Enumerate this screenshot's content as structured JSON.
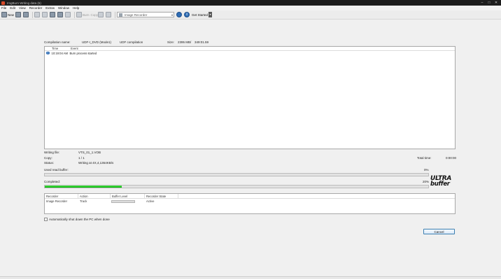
{
  "window": {
    "title": "ImgBurn Writing data (6)",
    "controls": [
      "–",
      "□",
      "✕"
    ]
  },
  "menu": [
    "File",
    "Edit",
    "View",
    "Recorder",
    "Extras",
    "Window",
    "Help"
  ],
  "toolbar": {
    "new_label": "New",
    "burn_label": "Burn",
    "copy_label": "Copy",
    "recorder_select": "Image Recorder",
    "get_started_label": "Get Started"
  },
  "compilation": {
    "name_label": "Compilation name:",
    "name_value": "UDF-I_DVD (Mode1)",
    "type_value": "UDF compilation",
    "size_label": "Size:",
    "size_value": "2395 MB",
    "size_sep": "/",
    "size_time": "349:01.59"
  },
  "log": {
    "headers": [
      "Time",
      "Event"
    ],
    "rows": [
      {
        "time": "10:19:04 AM",
        "event": "Burn process started"
      }
    ]
  },
  "status": {
    "writing_file_label": "Writing file:",
    "writing_file_value": "VTS_01_1.VOB",
    "copy_label": "Copy:",
    "copy_value": "1 / 1",
    "status_label": "Status:",
    "status_value": "Writing at 4X,4,1364KB/s",
    "total_time_label": "Total time:",
    "total_time_value": "0:00:00"
  },
  "buffer": {
    "label": "Used read buffer:",
    "percent_text": "0%",
    "fraction": 0.0
  },
  "completed": {
    "label": "Completed:",
    "percent_text": "20%",
    "fraction": 0.2
  },
  "ultra_buffer": {
    "line1": "ULTRA",
    "line2": "BUFFER"
  },
  "recorders": {
    "headers": [
      "Recorder",
      "Action",
      "Buffer Level",
      "Recorder State"
    ],
    "rows": [
      {
        "recorder": "Image Recorder",
        "action": "Track",
        "state": "Active"
      }
    ]
  },
  "shutdown_label": "Automatically shut down the PC when done",
  "cancel_label": "Cancel"
}
